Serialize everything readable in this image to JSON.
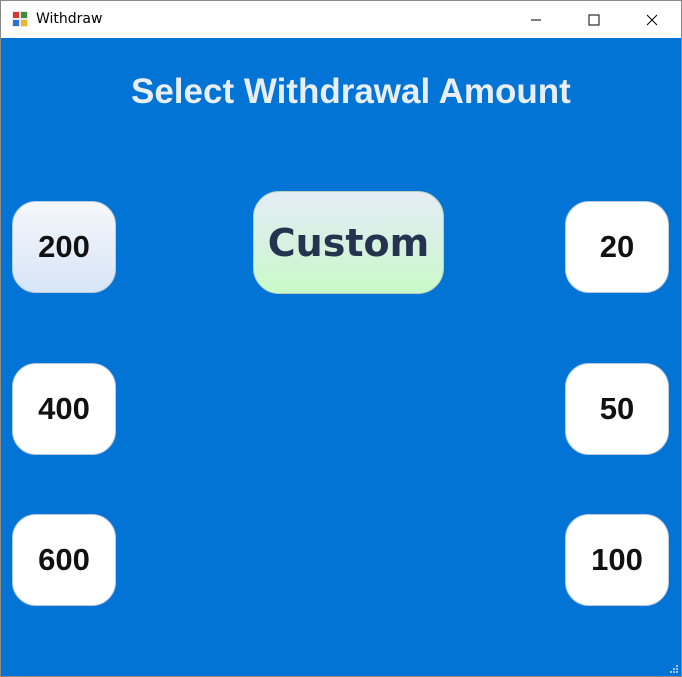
{
  "window": {
    "title": "Withdraw",
    "app_icon": "windows-app-icon",
    "controls": {
      "minimize_icon": "minimize-icon",
      "maximize_icon": "maximize-icon",
      "close_icon": "close-icon"
    }
  },
  "main": {
    "heading": "Select Withdrawal Amount",
    "custom_label": "Custom",
    "left_amounts": [
      "200",
      "400",
      "600"
    ],
    "right_amounts": [
      "20",
      "50",
      "100"
    ]
  },
  "colors": {
    "background": "#0174d6",
    "heading_text": "#e8eef6",
    "button_face": "#ffffff",
    "custom_gradient_top": "#e4edf4",
    "custom_gradient_bottom": "#c9fbc9",
    "custom_text": "#24344f"
  }
}
